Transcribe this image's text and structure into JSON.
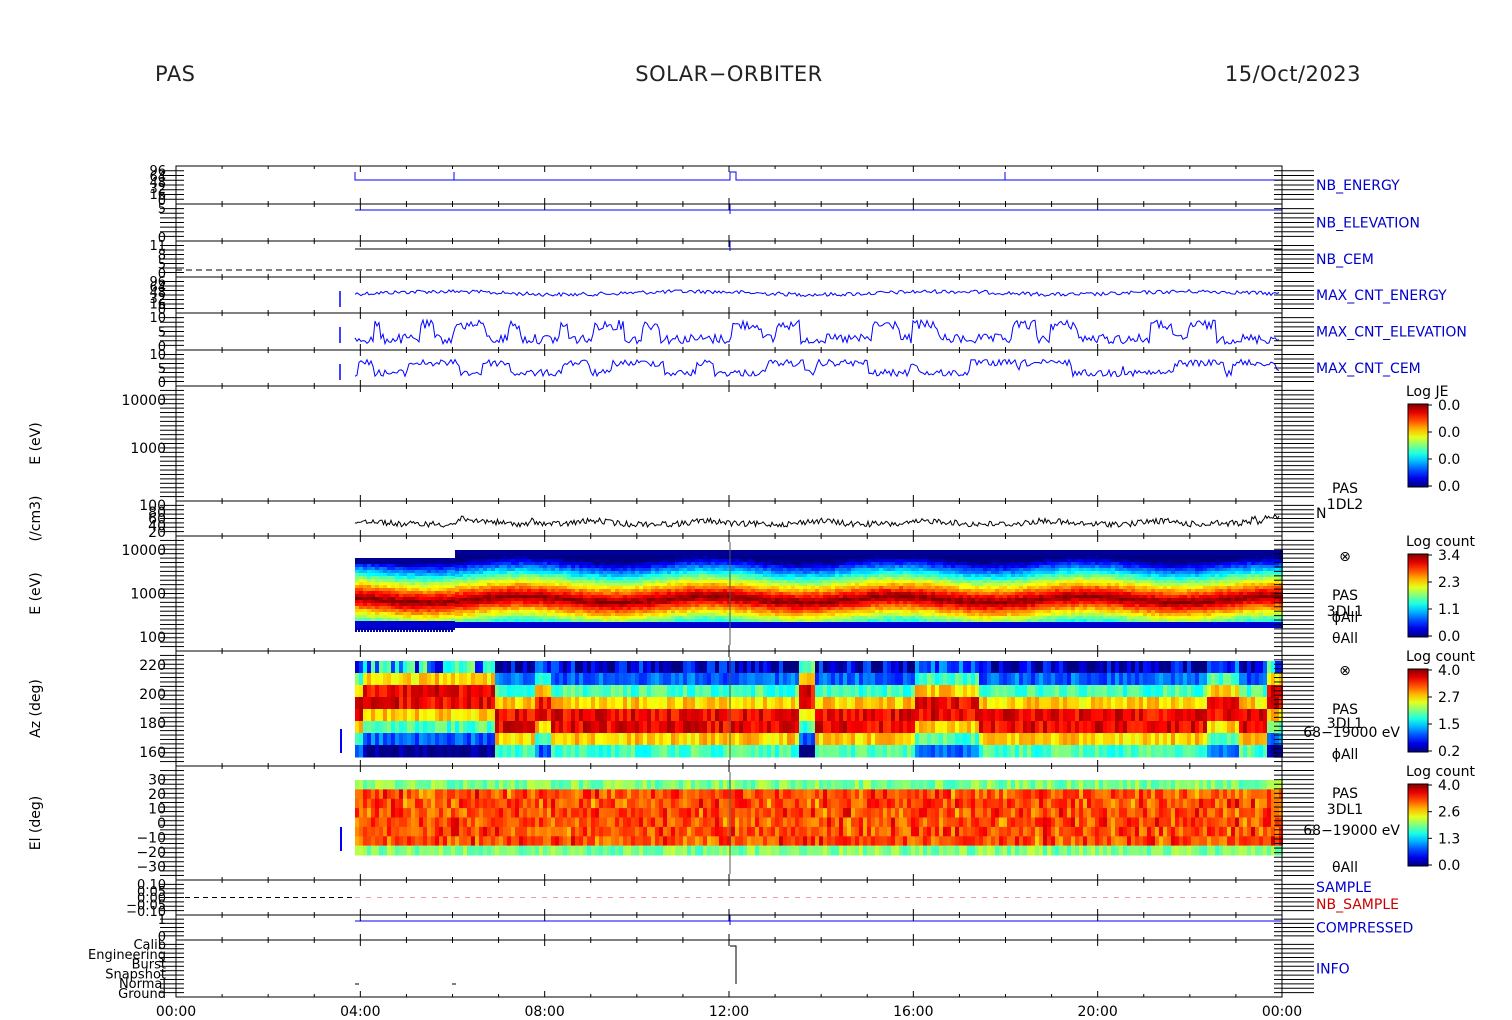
{
  "header": {
    "instrument": "PAS",
    "mission": "SOLAR−ORBITER",
    "date": "15/Oct/2023"
  },
  "colors": {
    "blue_label": "#0000cc",
    "red_label": "#cc0000",
    "axis": "#000000",
    "trace_blue": "#0000ff",
    "trace_black": "#000000"
  },
  "chart_data": {
    "type": "heatmap",
    "x_ticks": [
      "00:00",
      "04:00",
      "08:00",
      "12:00",
      "16:00",
      "20:00",
      "00:00"
    ],
    "xlim_hours": [
      0,
      24
    ],
    "panels": [
      {
        "id": "nb_energy",
        "label": "NB_ENERGY",
        "label_color": "#0000cc",
        "tick_labels": [
          "96",
          "64",
          "48",
          "32",
          "16",
          "0"
        ],
        "kind": "trace"
      },
      {
        "id": "nb_elevation",
        "label": "NB_ELEVATION",
        "label_color": "#0000cc",
        "tick_labels": [
          "5",
          "0"
        ],
        "kind": "trace"
      },
      {
        "id": "nb_cem",
        "label": "NB_CEM",
        "label_color": "#0000cc",
        "tick_labels": [
          "11",
          "8",
          "5",
          "0"
        ],
        "kind": "trace"
      },
      {
        "id": "max_cnt_energy",
        "label": "MAX_CNT_ENERGY",
        "label_color": "#0000cc",
        "tick_labels": [
          "96",
          "64",
          "48",
          "32",
          "16",
          "0"
        ],
        "kind": "trace"
      },
      {
        "id": "max_cnt_elevation",
        "label": "MAX_CNT_ELEVATION",
        "label_color": "#0000cc",
        "tick_labels": [
          "10",
          "5",
          "0"
        ],
        "kind": "trace"
      },
      {
        "id": "max_cnt_cem",
        "label": "MAX_CNT_CEM",
        "label_color": "#0000cc",
        "tick_labels": [
          "10",
          "5",
          "0"
        ],
        "kind": "trace"
      },
      {
        "id": "energy_1dl2",
        "ylabel": "E (eV)",
        "tick_labels": [
          "10000",
          "1000"
        ],
        "colorbar": {
          "title": "Log JE",
          "ticks": [
            "0.0",
            "0.0",
            "0.0",
            "0.0"
          ]
        },
        "kind": "empty"
      },
      {
        "id": "density",
        "ylabel": "(/cm3)",
        "tick_labels": [
          "100",
          "80",
          "60",
          "40",
          "20"
        ],
        "right_labels": [
          "PAS",
          "1DL2",
          "N"
        ],
        "kind": "line"
      },
      {
        "id": "energy_3dl1",
        "ylabel": "E (eV)",
        "tick_labels": [
          "10000",
          "1000",
          "100"
        ],
        "right_labels": [
          "⊗",
          "PAS",
          "3DL1",
          "ϕAll",
          "θAll"
        ],
        "colorbar": {
          "title": "Log count",
          "ticks": [
            "3.4",
            "2.3",
            "1.1",
            "0.0"
          ]
        },
        "kind": "spectrogram"
      },
      {
        "id": "azimuth",
        "ylabel": "Az (deg)",
        "tick_labels": [
          "220",
          "200",
          "180",
          "160"
        ],
        "right_labels": [
          "⊗",
          "PAS",
          "3DL1",
          "68−19000 eV",
          "ϕAll"
        ],
        "colorbar": {
          "title": "Log count",
          "ticks": [
            "4.0",
            "2.7",
            "1.5",
            "0.2"
          ]
        },
        "kind": "spectrogram"
      },
      {
        "id": "elevation",
        "ylabel": "El (deg)",
        "tick_labels": [
          "30",
          "20",
          "10",
          "0",
          "−10",
          "−20",
          "−30"
        ],
        "right_labels": [
          "PAS",
          "3DL1",
          "68−19000 eV",
          "θAll"
        ],
        "colorbar": {
          "title": "Log count",
          "ticks": [
            "4.0",
            "2.6",
            "1.3",
            "0.0"
          ]
        },
        "kind": "spectrogram"
      },
      {
        "id": "sample",
        "label": "SAMPLE",
        "label_color": "#0000cc",
        "label2": "NB_SAMPLE",
        "label2_color": "#cc0000",
        "tick_labels": [
          "0.10",
          "0.05",
          "0.00",
          "−0.05",
          "−0.10"
        ],
        "kind": "dashed"
      },
      {
        "id": "compressed",
        "label": "COMPRESSED",
        "label_color": "#0000cc",
        "tick_labels": [
          "1",
          "0"
        ],
        "kind": "trace"
      },
      {
        "id": "info",
        "label": "INFO",
        "label_color": "#0000cc",
        "tick_labels": [
          "Calib",
          "Engineering",
          "Burst",
          "Snapshot",
          "Normal",
          "Ground"
        ],
        "kind": "steps"
      }
    ]
  }
}
